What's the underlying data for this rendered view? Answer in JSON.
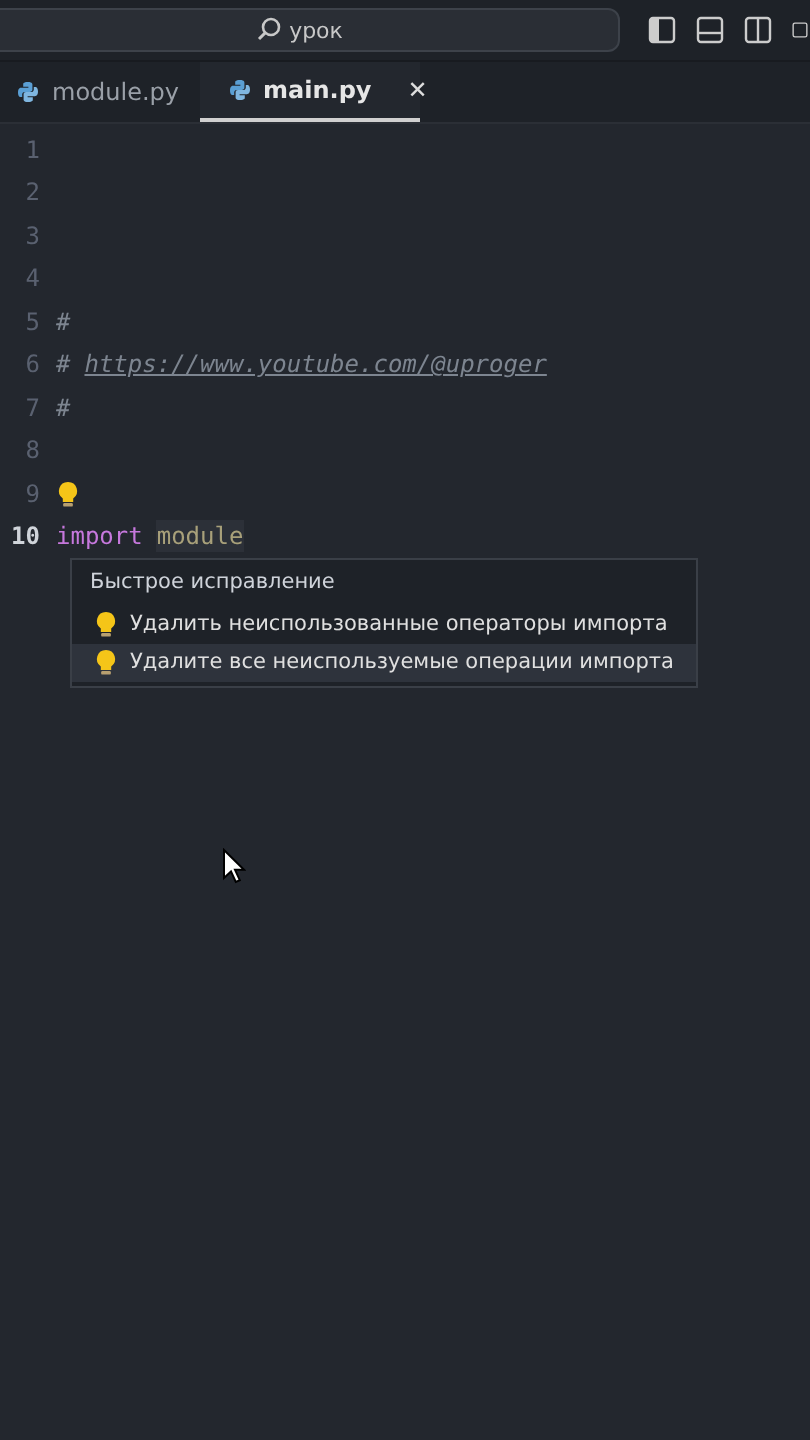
{
  "title_bar": {
    "search": {
      "placeholder": "урок"
    }
  },
  "tabs": [
    {
      "label": "module.py",
      "selected": false,
      "closable": false
    },
    {
      "label": "main.py",
      "selected": true,
      "closable": true
    }
  ],
  "close_glyph": "✕",
  "editor": {
    "lines": [
      {
        "number": "1",
        "current": false,
        "lightbulb": false
      },
      {
        "number": "2",
        "current": false,
        "lightbulb": false
      },
      {
        "number": "3",
        "current": false,
        "lightbulb": false
      },
      {
        "number": "4",
        "current": false,
        "lightbulb": false
      },
      {
        "number": "5",
        "current": false,
        "lightbulb": false,
        "tokens": [
          {
            "text": "#",
            "kind": "comment"
          }
        ]
      },
      {
        "number": "6",
        "current": false,
        "lightbulb": false,
        "tokens": [
          {
            "text": "#",
            "kind": "comment"
          },
          {
            "text": "https://www.youtube.com/@uproger",
            "kind": "link"
          }
        ]
      },
      {
        "number": "7",
        "current": false,
        "lightbulb": false,
        "tokens": [
          {
            "text": "#",
            "kind": "comment"
          }
        ]
      },
      {
        "number": "8",
        "current": false,
        "lightbulb": false
      },
      {
        "number": "9",
        "current": false,
        "lightbulb": true
      },
      {
        "number": "10",
        "current": true,
        "lightbulb": false,
        "tokens": [
          {
            "text": "import",
            "kind": "keyword"
          },
          {
            "text": "module",
            "kind": "unused"
          }
        ]
      }
    ],
    "quick_fix": {
      "title": "Быстрое исправление",
      "items": [
        {
          "label": "Удалить неиспользованные операторы импорта",
          "selected": false
        },
        {
          "label": "Удалите все неиспользуемые операции импорта",
          "selected": true
        }
      ]
    }
  }
}
